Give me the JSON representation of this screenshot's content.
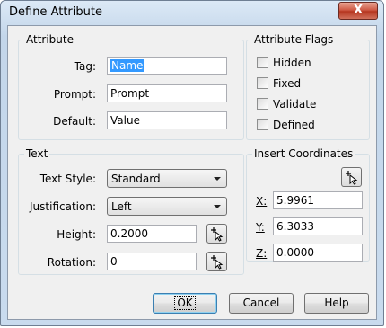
{
  "window": {
    "title": "Define Attribute",
    "close_glyph": "X"
  },
  "attribute": {
    "title": "Attribute",
    "tag_label": "Tag:",
    "tag_value": "Name",
    "prompt_label": "Prompt:",
    "prompt_value": "Prompt",
    "default_label": "Default:",
    "default_value": "Value"
  },
  "flags": {
    "title": "Attribute Flags",
    "items": [
      {
        "label": "Hidden",
        "checked": false
      },
      {
        "label": "Fixed",
        "checked": false
      },
      {
        "label": "Validate",
        "checked": false
      },
      {
        "label": "Defined",
        "checked": false
      }
    ]
  },
  "text": {
    "title": "Text",
    "style_label": "Text Style:",
    "style_value": "Standard",
    "justification_label": "Justification:",
    "justification_value": "Left",
    "height_label": "Height:",
    "height_value": "0.2000",
    "rotation_label": "Rotation:",
    "rotation_value": "0"
  },
  "coords": {
    "title": "Insert Coordinates",
    "x_label": "X:",
    "x_value": "5.9961",
    "y_label": "Y:",
    "y_value": "6.3033",
    "z_label": "Z:",
    "z_value": "0.0000"
  },
  "buttons": {
    "ok": "OK",
    "cancel": "Cancel",
    "help": "Help"
  },
  "icons": {
    "pick_point": "pick-point-icon",
    "close": "close-icon"
  }
}
